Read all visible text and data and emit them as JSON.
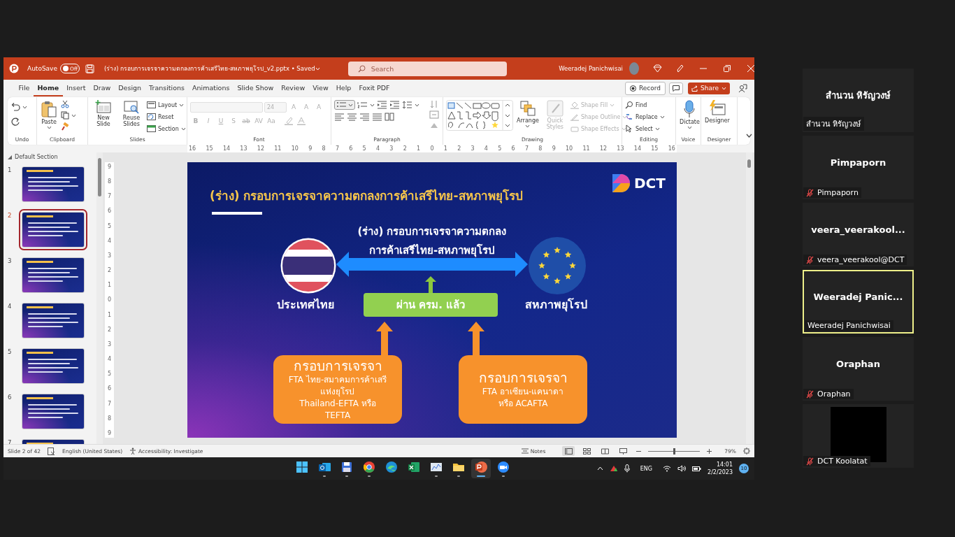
{
  "window": {
    "autosave_label": "AutoSave",
    "autosave": {
      "on": false,
      "label": "Off"
    },
    "title": "(ร่าง) กรอบการเจรจาความตกลงการค้าเสรีไทย-สหภาพยุโรป_v2.pptx • Saved",
    "search_placeholder": "Search",
    "user_name": "Weeradej Panichwisai"
  },
  "tabs": [
    {
      "label": "File",
      "selected": false
    },
    {
      "label": "Home",
      "selected": true
    },
    {
      "label": "Insert",
      "selected": false
    },
    {
      "label": "Draw",
      "selected": false
    },
    {
      "label": "Design",
      "selected": false
    },
    {
      "label": "Transitions",
      "selected": false
    },
    {
      "label": "Animations",
      "selected": false
    },
    {
      "label": "Slide Show",
      "selected": false
    },
    {
      "label": "Review",
      "selected": false
    },
    {
      "label": "View",
      "selected": false
    },
    {
      "label": "Help",
      "selected": false
    },
    {
      "label": "Foxit PDF",
      "selected": false
    }
  ],
  "tab_actions": {
    "record": "Record",
    "share": "Share"
  },
  "ribbon_groups": [
    {
      "kind": "undo",
      "label": "Undo"
    },
    {
      "kind": "clipboard",
      "label": "Clipboard",
      "paste": "Paste"
    },
    {
      "kind": "slides",
      "label": "Slides",
      "new_slide": "New Slide",
      "reuse_slides": "Reuse Slides",
      "commands": [
        "Layout",
        "Reset",
        "Section"
      ]
    },
    {
      "kind": "font",
      "label": "Font",
      "font_size": "24",
      "disabled": true,
      "size_buttons": [
        "A",
        "A",
        "A"
      ],
      "format_buttons": [
        "B",
        "I",
        "U",
        "S",
        "ab",
        "AV",
        "Aa"
      ]
    },
    {
      "kind": "paragraph",
      "label": "Paragraph"
    },
    {
      "kind": "drawing",
      "label": "Drawing",
      "arrange": "Arrange",
      "quick_styles": {
        "label": "Quick Styles",
        "disabled": true
      },
      "shape_commands": [
        {
          "label": "Shape Fill",
          "disabled": true
        },
        {
          "label": "Shape Outline",
          "disabled": true
        },
        {
          "label": "Shape Effects",
          "disabled": true
        }
      ]
    },
    {
      "kind": "editing",
      "label": "Editing",
      "commands": [
        "Find",
        "Replace",
        "Select"
      ]
    },
    {
      "kind": "voice",
      "label": "Voice",
      "command": "Dictate"
    },
    {
      "kind": "designer",
      "label": "Designer",
      "command": "Designer"
    }
  ],
  "ruler": {
    "horizontal": [
      "16",
      "15",
      "14",
      "13",
      "12",
      "11",
      "10",
      "9",
      "8",
      "7",
      "6",
      "5",
      "4",
      "3",
      "2",
      "1",
      "0",
      "1",
      "2",
      "3",
      "4",
      "5",
      "6",
      "7",
      "8",
      "9",
      "10",
      "11",
      "12",
      "13",
      "14",
      "15",
      "16"
    ],
    "vertical": [
      "9",
      "8",
      "7",
      "6",
      "5",
      "4",
      "3",
      "2",
      "1",
      "0",
      "1",
      "2",
      "3",
      "4",
      "5",
      "6",
      "7",
      "8",
      "9"
    ]
  },
  "slide_panel": {
    "section": "Default Section",
    "thumbnails": [
      {
        "number": "1",
        "selected": false
      },
      {
        "number": "2",
        "selected": true
      },
      {
        "number": "3",
        "selected": false
      },
      {
        "number": "4",
        "selected": false
      },
      {
        "number": "5",
        "selected": false
      },
      {
        "number": "6",
        "selected": false
      },
      {
        "number": "7",
        "selected": false
      }
    ]
  },
  "slide": {
    "title": "(ร่าง) กรอบการเจรจาความตกลงการค้าเสรีไทย-สหภาพยุโรป",
    "logo_text": "DCT",
    "heading_lines": [
      "(ร่าง) กรอบการเจรจาความตกลง",
      "การค้าเสรีไทย-สหภาพยุโรป"
    ],
    "left_party": "ประเทศไทย",
    "right_party": "สหภาพยุโรป",
    "approval": "ผ่าน ครม. แล้ว",
    "frameworks": [
      {
        "title": "กรอบการเจรจา",
        "body_lines": [
          "FTA ไทย-สมาคมการค้าเสรี",
          "แห่งยุโรป",
          "Thailand-EFTA หรือ",
          "TEFTA"
        ]
      },
      {
        "title": "กรอบการเจรจา",
        "body_lines": [
          "FTA อาเซียน-แคนาดา",
          "หรือ ACAFTA"
        ]
      }
    ]
  },
  "status_bar": {
    "slide_count": "Slide 2 of 42",
    "language": "English (United States)",
    "accessibility": "Accessibility: Investigate",
    "notes": "Notes",
    "views": [
      {
        "selected": true
      },
      {
        "selected": false
      },
      {
        "selected": false
      },
      {
        "selected": false
      }
    ],
    "zoom": {
      "level": 0.5,
      "reading": "79%"
    }
  },
  "taskbar": {
    "apps": [
      {
        "kind": "start",
        "running": false,
        "active": false
      },
      {
        "kind": "mail",
        "running": true,
        "active": false
      },
      {
        "kind": "disk",
        "running": true,
        "active": false
      },
      {
        "kind": "browser",
        "running": true,
        "active": false
      },
      {
        "kind": "wave",
        "running": false,
        "active": false
      },
      {
        "kind": "sheet",
        "running": false,
        "active": false
      },
      {
        "kind": "chart",
        "running": true,
        "active": false
      },
      {
        "kind": "folder",
        "running": true,
        "active": false
      },
      {
        "kind": "slides",
        "running": true,
        "active": true
      },
      {
        "kind": "video",
        "running": true,
        "active": false
      }
    ],
    "language": "ENG",
    "time": "14:01",
    "date": "2/2/2023",
    "notification_count": "10"
  },
  "participants": [
    {
      "kind": "name",
      "display": "สำนวน หิรัญวงษ์",
      "label": "สำนวน หิรัญวงษ์",
      "muted": false,
      "speaking": false
    },
    {
      "kind": "name",
      "display": "Pimpaporn",
      "label": "Pimpaporn",
      "muted": true,
      "speaking": false
    },
    {
      "kind": "name",
      "display": "veera_veerakool...",
      "label": "veera_veerakool@DCT",
      "muted": true,
      "speaking": false
    },
    {
      "kind": "name",
      "display": "Weeradej  Panic...",
      "label": "Weeradej Panichwisai",
      "muted": false,
      "speaking": true
    },
    {
      "kind": "name",
      "display": "Oraphan",
      "label": "Oraphan",
      "muted": true,
      "speaking": false
    },
    {
      "kind": "video",
      "label": "DCT Koolatat",
      "muted": true,
      "speaking": false
    }
  ]
}
